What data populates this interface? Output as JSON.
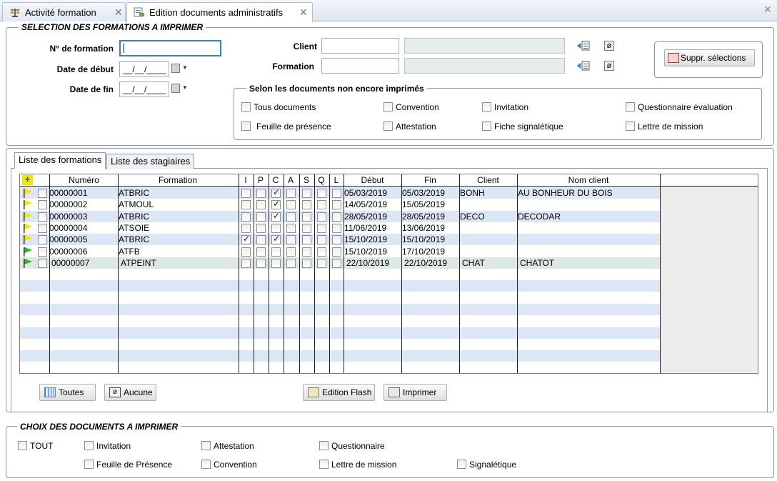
{
  "tabs": [
    {
      "label": "Activité formation"
    },
    {
      "label": "Edition documents administratifs"
    }
  ],
  "selection": {
    "legend": "SELECTION DES FORMATIONS A IMPRIMER",
    "num_formation_label": "N° de formation",
    "num_formation_value": "",
    "date_debut_label": "Date de début",
    "date_debut_value": "__/__/____",
    "date_fin_label": "Date de fin",
    "date_fin_value": "__/__/____",
    "client_label": "Client",
    "formation_label": "Formation",
    "suppr_label": "Suppr. sélections"
  },
  "non_imprimes": {
    "legend": "Selon les documents non encore imprimés",
    "options": [
      "Tous documents",
      "Convention",
      "Invitation",
      "Questionnaire évaluation",
      "Feuille de présence",
      "Attestation",
      "Fiche signalétique",
      "Lettre de mission"
    ]
  },
  "list_tabs": [
    "Liste des formations",
    "Liste des stagiaires"
  ],
  "grid": {
    "headers": [
      "Numéro",
      "Formation",
      "I",
      "P",
      "C",
      "A",
      "S",
      "Q",
      "L",
      "Début",
      "Fin",
      "Client",
      "Nom client"
    ],
    "rows": [
      {
        "flag": "yellow",
        "numero": "00000001",
        "formation": "ATBRIC",
        "I": false,
        "P": false,
        "C": true,
        "A": false,
        "S": false,
        "Q": false,
        "L": false,
        "debut": "05/03/2019",
        "fin": "05/03/2019",
        "client": "BONH",
        "nom": "AU BONHEUR DU BOIS"
      },
      {
        "flag": "yellow",
        "numero": "00000002",
        "formation": "ATMOUL",
        "I": false,
        "P": false,
        "C": true,
        "A": false,
        "S": false,
        "Q": false,
        "L": false,
        "debut": "14/05/2019",
        "fin": "15/05/2019",
        "client": "",
        "nom": ""
      },
      {
        "flag": "yellow",
        "numero": "00000003",
        "formation": "ATBRIC",
        "I": false,
        "P": false,
        "C": true,
        "A": false,
        "S": false,
        "Q": false,
        "L": false,
        "debut": "28/05/2019",
        "fin": "28/05/2019",
        "client": "DECO",
        "nom": "DECODAR"
      },
      {
        "flag": "yellow",
        "numero": "00000004",
        "formation": "ATSOIE",
        "I": false,
        "P": false,
        "C": false,
        "A": false,
        "S": false,
        "Q": false,
        "L": false,
        "debut": "11/06/2019",
        "fin": "13/06/2019",
        "client": "",
        "nom": ""
      },
      {
        "flag": "yellow",
        "numero": "00000005",
        "formation": "ATBRIC",
        "I": true,
        "P": false,
        "C": true,
        "A": false,
        "S": false,
        "Q": false,
        "L": false,
        "debut": "15/10/2019",
        "fin": "15/10/2019",
        "client": "",
        "nom": ""
      },
      {
        "flag": "green",
        "numero": "00000006",
        "formation": "ATFB",
        "I": false,
        "P": false,
        "C": false,
        "A": false,
        "S": false,
        "Q": false,
        "L": false,
        "debut": "15/10/2019",
        "fin": "17/10/2019",
        "client": "",
        "nom": ""
      },
      {
        "flag": "green",
        "numero": "00000007",
        "formation": "ATPEINT",
        "I": false,
        "P": false,
        "C": false,
        "A": false,
        "S": false,
        "Q": false,
        "L": false,
        "debut": "22/10/2019",
        "fin": "22/10/2019",
        "client": "CHAT",
        "nom": "CHATOT"
      }
    ]
  },
  "buttons": {
    "toutes": "Toutes",
    "aucune": "Aucune",
    "edition_flash": "Edition Flash",
    "imprimer": "Imprimer"
  },
  "choix": {
    "legend": "CHOIX DES DOCUMENTS A IMPRIMER",
    "options": [
      "TOUT",
      "Invitation",
      "Attestation",
      "Questionnaire",
      "Feuille de Présence",
      "Convention",
      "Lettre de mission",
      "Signalétique"
    ]
  },
  "colors": {
    "row_alt": "#dce6f4",
    "row_selected": "#dde8e3",
    "flag_yellow": "#f5e400",
    "flag_green": "#2bb52b",
    "border": "#7f9db9"
  }
}
